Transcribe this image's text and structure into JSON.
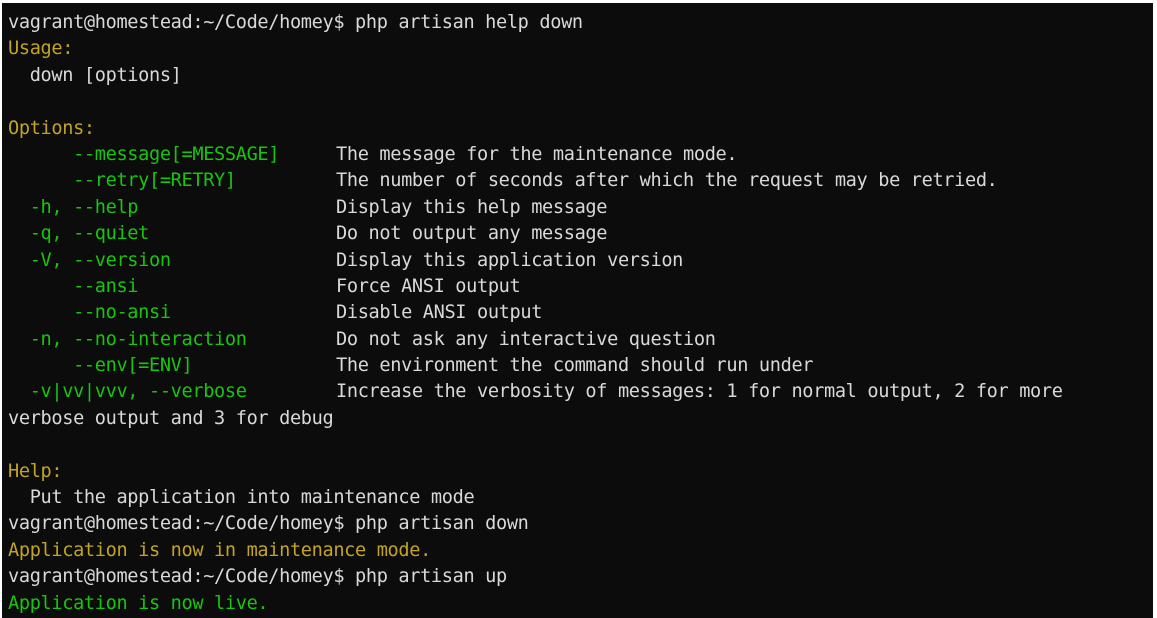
{
  "colors": {
    "background": "#0c0c0c",
    "text": "#d9d9d9",
    "option_green": "#16c60c",
    "heading_yellow": "#c3a420"
  },
  "lines": {
    "prompt1": "vagrant@homestead:~/Code/homey$ php artisan help down",
    "usage_heading": "Usage:",
    "usage_text": "  down [options]",
    "options_heading": "Options:",
    "options": [
      {
        "flag": "      --message[=MESSAGE]",
        "desc": "The message for the maintenance mode."
      },
      {
        "flag": "      --retry[=RETRY]",
        "desc": "The number of seconds after which the request may be retried."
      },
      {
        "flag": "  -h, --help",
        "desc": "Display this help message"
      },
      {
        "flag": "  -q, --quiet",
        "desc": "Do not output any message"
      },
      {
        "flag": "  -V, --version",
        "desc": "Display this application version"
      },
      {
        "flag": "      --ansi",
        "desc": "Force ANSI output"
      },
      {
        "flag": "      --no-ansi",
        "desc": "Disable ANSI output"
      },
      {
        "flag": "  -n, --no-interaction",
        "desc": "Do not ask any interactive question"
      },
      {
        "flag": "      --env[=ENV]",
        "desc": "The environment the command should run under"
      },
      {
        "flag": "  -v|vv|vvv, --verbose",
        "desc": "Increase the verbosity of messages: 1 for normal output, 2 for more"
      }
    ],
    "verbose_wrap": "verbose output and 3 for debug",
    "help_heading": "Help:",
    "help_text": "  Put the application into maintenance mode",
    "prompt2": "vagrant@homestead:~/Code/homey$ php artisan down",
    "down_result": "Application is now in maintenance mode.",
    "prompt3": "vagrant@homestead:~/Code/homey$ php artisan up",
    "up_result": "Application is now live."
  }
}
